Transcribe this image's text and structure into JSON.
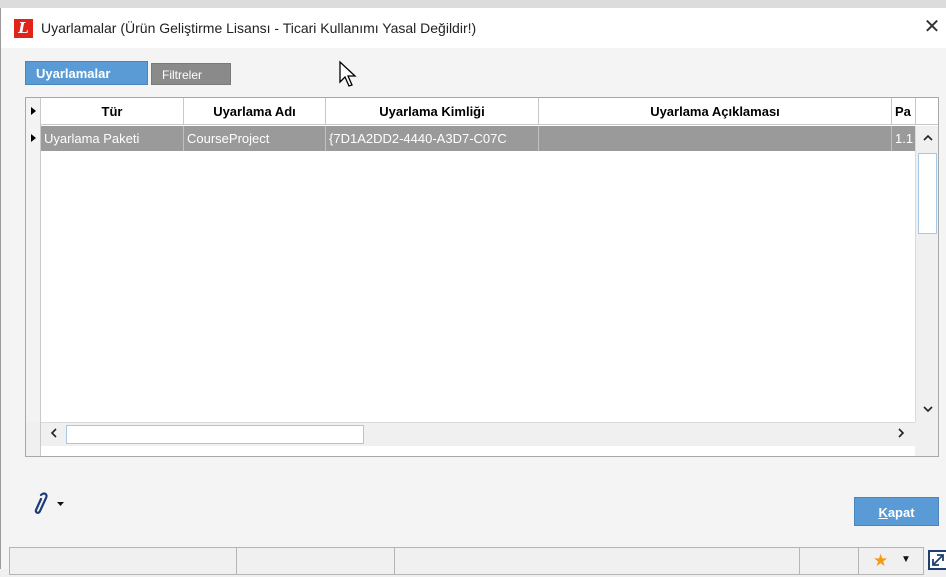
{
  "window": {
    "title": "Uyarlamalar (Ürün Geliştirme Lisansı - Ticari Kullanımı Yasal Değildir!)",
    "logo_letter": "L",
    "close_glyph": "✕"
  },
  "tabs": [
    {
      "label": "Uyarlamalar",
      "active": true
    },
    {
      "label": "Filtreler",
      "active": false
    }
  ],
  "grid": {
    "columns": [
      "Tür",
      "Uyarlama Adı",
      "Uyarlama Kimliği",
      "Uyarlama Açıklaması",
      "Pa"
    ],
    "rows": [
      [
        "Uyarlama Paketi",
        "CourseProject",
        "{7D1A2DD2-4440-A3D7-C07C",
        "",
        "1.1"
      ]
    ]
  },
  "footer": {
    "close_button": {
      "underlined": "K",
      "rest": "apat"
    }
  },
  "icons": {
    "app_logo": "logo-icon",
    "attach": "paperclip-icon",
    "favorite": "star-icon",
    "expand": "expand-icon"
  },
  "colors": {
    "accent": "#5b9bd5",
    "selected_row": "#9a9a9a",
    "logo_red": "#e2231a",
    "star": "#f39c12"
  }
}
